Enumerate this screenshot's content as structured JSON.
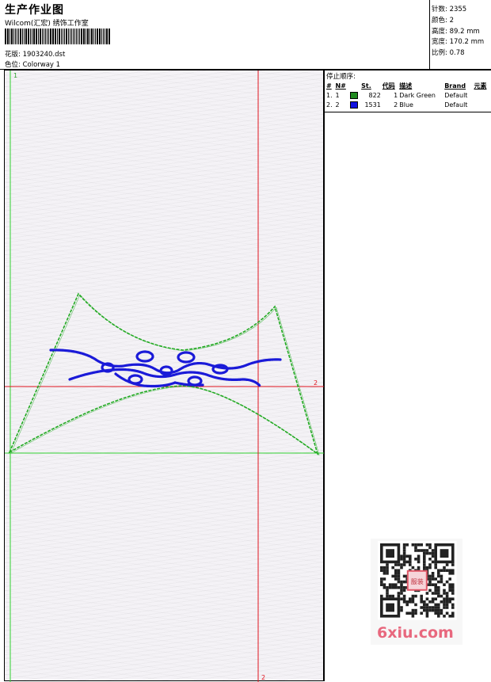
{
  "header": {
    "title": "生产作业图",
    "company": "Wilcom(汇宏) 绣饰工作室",
    "file_label": "花版:",
    "file_value": "1903240.dst",
    "colorway_label": "色位:",
    "colorway_value": "Colorway 1"
  },
  "stats": {
    "stitches_label": "针数:",
    "stitches_value": "2355",
    "colors_label": "颜色:",
    "colors_value": "2",
    "height_label": "高度:",
    "height_value": "89.2 mm",
    "width_label": "宽度:",
    "width_value": "170.2 mm",
    "scale_label": "比例:",
    "scale_value": "0.78"
  },
  "design": {
    "top_marker": "1",
    "right_marker": "2",
    "bottom_marker": "2",
    "outline_color": "#22aa22",
    "motif_color": "#1a1ad8",
    "guide_color": "#e0141e",
    "axis_color": "#30d030"
  },
  "stop_sequence": {
    "title": "停止顺序:",
    "headers": [
      "#",
      "N#",
      "St.",
      "代码",
      "描述",
      "Brand",
      "元素"
    ],
    "rows": [
      {
        "idx": "1.",
        "n": "1",
        "color": "#1f8a1f",
        "st": "822",
        "code": "1",
        "desc": "Dark Green",
        "brand": "Default"
      },
      {
        "idx": "2.",
        "n": "2",
        "color": "#1010e0",
        "st": "1531",
        "code": "2",
        "desc": "Blue",
        "brand": "Default"
      }
    ]
  },
  "watermark": {
    "text": "6xiu.com",
    "seal_text": "服装图库"
  }
}
